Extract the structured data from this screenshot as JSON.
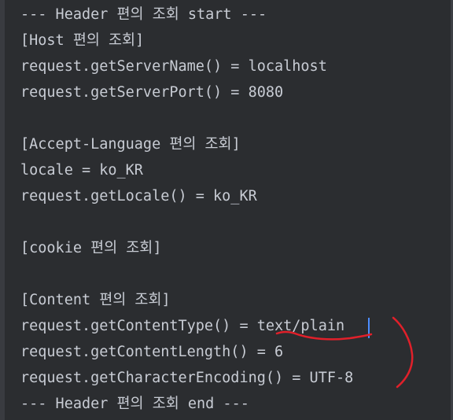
{
  "console": {
    "lines": [
      "--- Header 편의 조회 start ---",
      "[Host 편의 조회]",
      "request.getServerName() = localhost",
      "request.getServerPort() = 8080",
      "",
      "[Accept-Language 편의 조회]",
      "locale = ko_KR",
      "request.getLocale() = ko_KR",
      "",
      "[cookie 편의 조회]",
      "",
      "[Content 편의 조회]",
      "request.getContentType() = text/plain",
      "request.getContentLength() = 6",
      "request.getCharacterEncoding() = UTF-8",
      "--- Header 편의 조회 end ---"
    ]
  },
  "colors": {
    "background": "#2b2d30",
    "text": "#c8ccd4",
    "annotation": "#e0202a",
    "caret": "#4c8dff"
  }
}
